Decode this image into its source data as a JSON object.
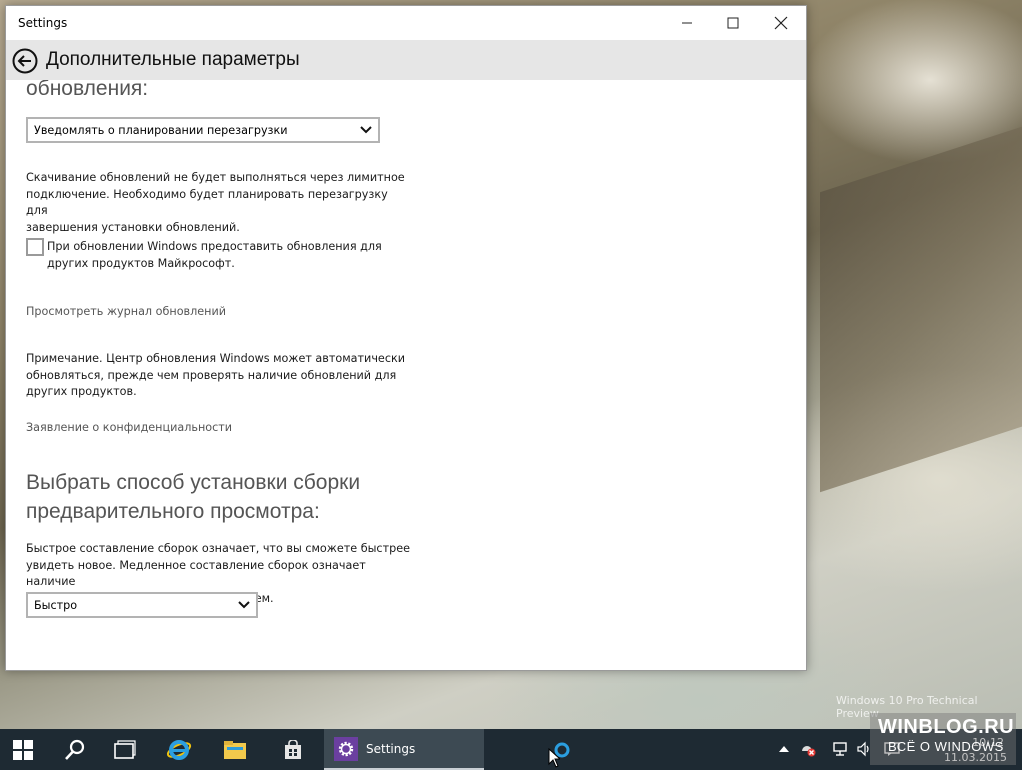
{
  "window": {
    "title": "Settings",
    "page_title": "Дополнительные параметры"
  },
  "content": {
    "cut_heading": "обновления:",
    "restart_select": {
      "value": "Уведомлять о планировании перезагрузки"
    },
    "metered_text": [
      "Скачивание обновлений не будет выполняться через лимитное",
      "подключение. Необходимо будет планировать перезагрузку для",
      "завершения установки обновлений."
    ],
    "other_products_checkbox": {
      "checked": false,
      "label": [
        "При обновлении Windows предоставить обновления для",
        "других продуктов Майкрософт."
      ]
    },
    "history_link": "Просмотреть журнал обновлений",
    "note_text": [
      "Примечание. Центр обновления Windows может автоматически",
      "обновляться, прежде чем проверять наличие обновлений для",
      "других продуктов."
    ],
    "privacy_link": "Заявление о конфиденциальности",
    "build_heading": [
      "Выбрать способ установки сборки",
      "предварительного просмотра:"
    ],
    "build_text": [
      "Быстрое составление сборок означает, что вы сможете быстрее",
      "увидеть новое. Медленное составление сборок означает наличие",
      "нескольких вариантов решения проблем."
    ],
    "build_select": {
      "value": "Быстро"
    }
  },
  "desktop": {
    "watermark": "Windows 10 Pro Technical Preview"
  },
  "taskbar": {
    "settings_label": "Settings",
    "clock_time": "10:12",
    "clock_date": "11.03.2015",
    "accent": "#6b3fa0"
  },
  "overlay_watermark": {
    "line1": "WINBLOG.RU",
    "line2": "ВСЁ О WINDOWS"
  }
}
